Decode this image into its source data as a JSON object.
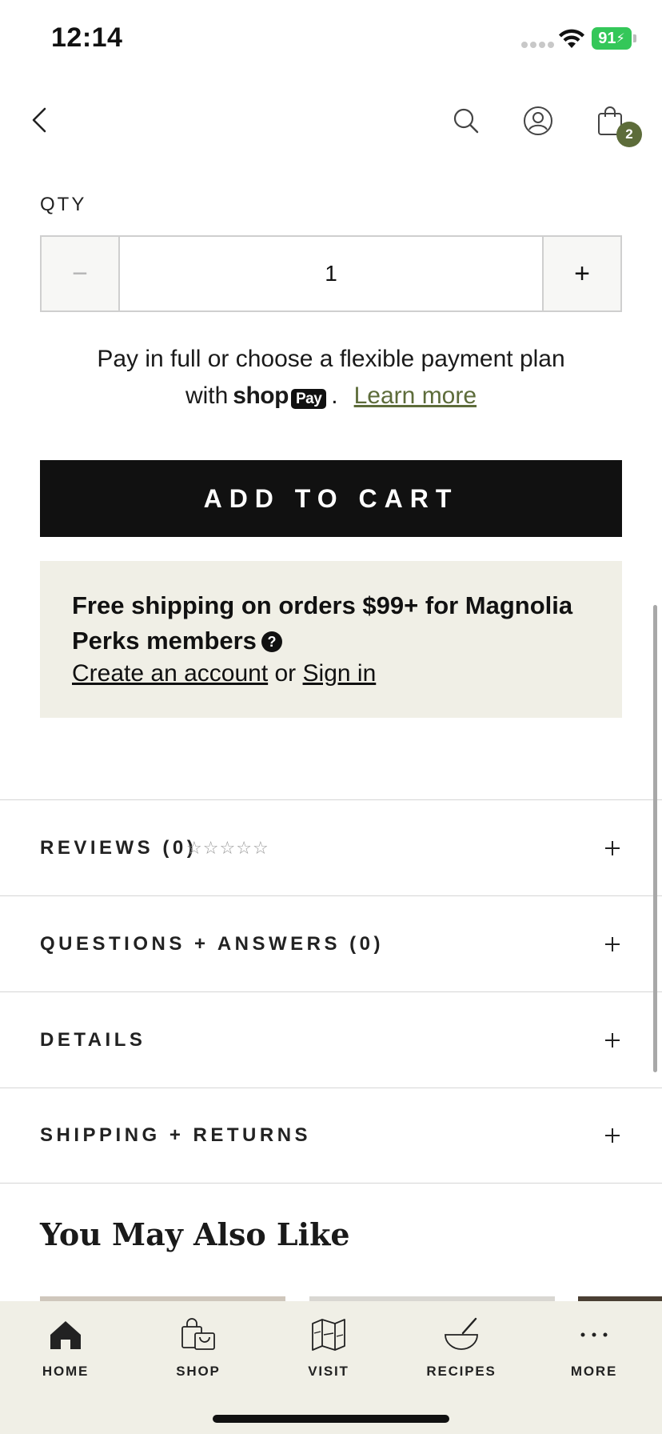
{
  "status_bar": {
    "time": "12:14",
    "battery": "91"
  },
  "nav": {
    "cart_count": "2"
  },
  "qty": {
    "label": "QTY",
    "minus": "−",
    "value": "1",
    "plus": "+"
  },
  "payment": {
    "line1": "Pay in full or choose a flexible payment plan",
    "with": "with",
    "shop_word": "shop",
    "pay_pill": "Pay",
    "period": ".",
    "learn_more": "Learn more"
  },
  "add_to_cart": "ADD TO CART",
  "promo": {
    "title": "Free shipping on orders $99+ for Magnolia Perks members",
    "help": "?",
    "create_account": "Create an account",
    "or": "or",
    "sign_in": "Sign in"
  },
  "accordion": [
    {
      "label": "REVIEWS (0)",
      "rating": 0,
      "max_rating": 5
    },
    {
      "label": "QUESTIONS + ANSWERS (0)"
    },
    {
      "label": "DETAILS"
    },
    {
      "label": "SHIPPING + RETURNS"
    }
  ],
  "recommendations": {
    "title": "You May Also Like"
  },
  "tab_bar": [
    {
      "label": "HOME",
      "icon": "home-icon",
      "active": true
    },
    {
      "label": "SHOP",
      "icon": "shopping-bags-icon"
    },
    {
      "label": "VISIT",
      "icon": "map-icon"
    },
    {
      "label": "RECIPES",
      "icon": "mixing-bowl-icon"
    },
    {
      "label": "MORE",
      "icon": "more-icon"
    }
  ],
  "colors": {
    "accent": "#5d6c3a",
    "promo_bg": "#f0efe6",
    "button_bg": "#111111"
  }
}
